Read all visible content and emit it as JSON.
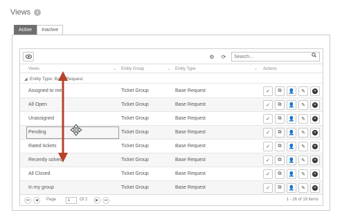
{
  "page": {
    "title": "Views"
  },
  "tabs": [
    {
      "label": "Active",
      "active": true
    },
    {
      "label": "Inactive",
      "active": false
    }
  ],
  "toolbar": {
    "search_placeholder": "Search..."
  },
  "columns": {
    "views": "Views",
    "entity_group": "Entity Group",
    "entity_type": "Entity Type",
    "actions": "Actions"
  },
  "group": {
    "label": "Entity Type: Base Request"
  },
  "rows": [
    {
      "name": "Assigned to me",
      "entity_group": "Ticket Group",
      "entity_type": "Base Request"
    },
    {
      "name": "All Open",
      "entity_group": "Ticket Group",
      "entity_type": "Base Request"
    },
    {
      "name": "Unassigned",
      "entity_group": "Ticket Group",
      "entity_type": "Base Request"
    },
    {
      "name": "Pending",
      "entity_group": "Ticket Group",
      "entity_type": "Base Request"
    },
    {
      "name": "Rated tickets",
      "entity_group": "Ticket Group",
      "entity_type": "Base Request"
    },
    {
      "name": "Recently solved",
      "entity_group": "Ticket Group",
      "entity_type": "Base Request"
    },
    {
      "name": "All Closed",
      "entity_group": "Ticket Group",
      "entity_type": "Base Request"
    },
    {
      "name": "In my group",
      "entity_group": "Ticket Group",
      "entity_type": "Base Request"
    }
  ],
  "pager": {
    "page_label": "Page",
    "page_value": "1",
    "of_label": "Of 2",
    "count_text": "1 - 26 of 19 items"
  },
  "colors": {
    "drag_arrow": "#b8422a",
    "active_tab": "#6f6f6f"
  }
}
